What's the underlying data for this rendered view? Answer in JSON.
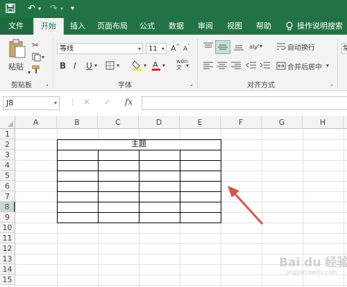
{
  "tabs": {
    "file": "文件",
    "home": "开始",
    "insert": "插入",
    "layout": "页面布局",
    "formulas": "公式",
    "data": "数据",
    "review": "审阅",
    "view": "视图",
    "help": "帮助",
    "tell_me": "操作说明搜索"
  },
  "ribbon": {
    "paste": "粘贴",
    "clipboard_group": "剪贴板",
    "font_name": "等线",
    "font_size": "11",
    "bold": "B",
    "italic": "I",
    "underline": "U",
    "font_group": "字体",
    "wrap_text": "自动换行",
    "merge_center": "合并后居中",
    "align_group": "对齐方式",
    "number_format_partial": "常"
  },
  "formula_bar": {
    "name_box": "J8",
    "fx": "fx",
    "cancel": "✕",
    "enter": "✓",
    "formula": ""
  },
  "sheet": {
    "columns": [
      "A",
      "B",
      "C",
      "D",
      "E",
      "F",
      "G",
      "H"
    ],
    "rows": [
      "1",
      "2",
      "3",
      "4",
      "5",
      "6",
      "7",
      "8",
      "9",
      "10",
      "11",
      "12",
      "13",
      "14",
      "15"
    ],
    "selected_row": "8",
    "title_cell": "主题"
  },
  "watermark": {
    "text": "Bai du 经验",
    "sub": "jingyan.baidu.com"
  },
  "colors": {
    "excel_green": "#217346",
    "arrow_red": "#d9534f"
  }
}
